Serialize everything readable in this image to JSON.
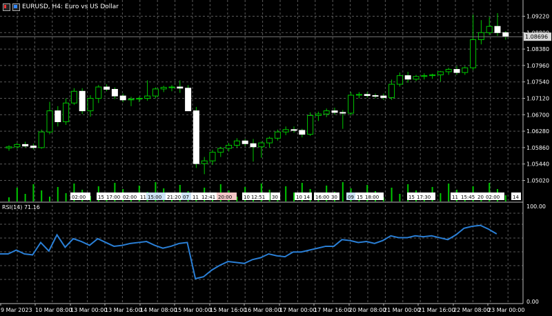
{
  "header": {
    "symbol": "EURUSD, H4:",
    "description": "Euro vs US Dollar"
  },
  "indicator": {
    "label": "RSI(14) 71.16"
  },
  "price_marker": "1.08696",
  "colors": {
    "background": "#000000",
    "grid": "#5a5a5a",
    "bull": "#00c800",
    "bear": "#ffffff",
    "rsi_line": "#2a7fd6",
    "volume": "#00c800",
    "price_line": "#7a7a7a"
  },
  "chart_data": [
    {
      "type": "candlestick",
      "y_ticks": [
        "1.09220",
        "1.08800",
        "1.08380",
        "1.07960",
        "1.07540",
        "1.07120",
        "1.06700",
        "1.06280",
        "1.05860",
        "1.05440",
        "1.05020"
      ],
      "ylim": [
        1.0487,
        1.0937
      ],
      "x_ticks": [
        "9 Mar 2023",
        "10 Mar 08:00",
        "13 Mar 00:00",
        "13 Mar 16:00",
        "14 Mar 08:00",
        "15 Mar 00:00",
        "15 Mar 16:00",
        "16 Mar 08:00",
        "17 Mar 00:00",
        "17 Mar 16:00",
        "20 Mar 08:00",
        "21 Mar 00:00",
        "21 Mar 16:00",
        "22 Mar 08:00",
        "23 Mar 00:00"
      ],
      "current_price": 1.08696,
      "candles": [
        {
          "o": 1.0585,
          "h": 1.0592,
          "l": 1.0578,
          "c": 1.0588
        },
        {
          "o": 1.0588,
          "h": 1.0598,
          "l": 1.0583,
          "c": 1.0594
        },
        {
          "o": 1.0594,
          "h": 1.0601,
          "l": 1.0586,
          "c": 1.059
        },
        {
          "o": 1.059,
          "h": 1.0596,
          "l": 1.0581,
          "c": 1.0586
        },
        {
          "o": 1.0586,
          "h": 1.0632,
          "l": 1.0583,
          "c": 1.0626
        },
        {
          "o": 1.0626,
          "h": 1.0703,
          "l": 1.062,
          "c": 1.068
        },
        {
          "o": 1.068,
          "h": 1.0692,
          "l": 1.064,
          "c": 1.0652
        },
        {
          "o": 1.0652,
          "h": 1.0712,
          "l": 1.0644,
          "c": 1.07
        },
        {
          "o": 1.07,
          "h": 1.0738,
          "l": 1.0695,
          "c": 1.073
        },
        {
          "o": 1.073,
          "h": 1.0738,
          "l": 1.0672,
          "c": 1.068
        },
        {
          "o": 1.068,
          "h": 1.072,
          "l": 1.0665,
          "c": 1.0712
        },
        {
          "o": 1.0712,
          "h": 1.0746,
          "l": 1.07,
          "c": 1.0741
        },
        {
          "o": 1.0741,
          "h": 1.0748,
          "l": 1.073,
          "c": 1.0735
        },
        {
          "o": 1.0735,
          "h": 1.074,
          "l": 1.071,
          "c": 1.0718
        },
        {
          "o": 1.0718,
          "h": 1.0724,
          "l": 1.0702,
          "c": 1.0708
        },
        {
          "o": 1.0708,
          "h": 1.0716,
          "l": 1.0692,
          "c": 1.071
        },
        {
          "o": 1.071,
          "h": 1.0716,
          "l": 1.0702,
          "c": 1.0712
        },
        {
          "o": 1.0712,
          "h": 1.0758,
          "l": 1.0706,
          "c": 1.0718
        },
        {
          "o": 1.0718,
          "h": 1.074,
          "l": 1.0712,
          "c": 1.0736
        },
        {
          "o": 1.0736,
          "h": 1.0744,
          "l": 1.0728,
          "c": 1.074
        },
        {
          "o": 1.074,
          "h": 1.0746,
          "l": 1.073,
          "c": 1.0741
        },
        {
          "o": 1.0741,
          "h": 1.0758,
          "l": 1.0726,
          "c": 1.0738
        },
        {
          "o": 1.0738,
          "h": 1.0746,
          "l": 1.0692,
          "c": 1.068
        },
        {
          "o": 1.068,
          "h": 1.069,
          "l": 1.0534,
          "c": 1.0545
        },
        {
          "o": 1.0545,
          "h": 1.0562,
          "l": 1.0518,
          "c": 1.0552
        },
        {
          "o": 1.0552,
          "h": 1.058,
          "l": 1.0542,
          "c": 1.0574
        },
        {
          "o": 1.0574,
          "h": 1.0588,
          "l": 1.0562,
          "c": 1.0584
        },
        {
          "o": 1.0584,
          "h": 1.0598,
          "l": 1.0576,
          "c": 1.0592
        },
        {
          "o": 1.0592,
          "h": 1.061,
          "l": 1.0586,
          "c": 1.0603
        },
        {
          "o": 1.0603,
          "h": 1.0608,
          "l": 1.059,
          "c": 1.0596
        },
        {
          "o": 1.0596,
          "h": 1.0608,
          "l": 1.055,
          "c": 1.0588
        },
        {
          "o": 1.0588,
          "h": 1.0602,
          "l": 1.056,
          "c": 1.0598
        },
        {
          "o": 1.0598,
          "h": 1.0614,
          "l": 1.0586,
          "c": 1.061
        },
        {
          "o": 1.061,
          "h": 1.0632,
          "l": 1.0604,
          "c": 1.0626
        },
        {
          "o": 1.0626,
          "h": 1.064,
          "l": 1.0618,
          "c": 1.0632
        },
        {
          "o": 1.0632,
          "h": 1.064,
          "l": 1.0624,
          "c": 1.063
        },
        {
          "o": 1.063,
          "h": 1.0634,
          "l": 1.0612,
          "c": 1.062
        },
        {
          "o": 1.062,
          "h": 1.0676,
          "l": 1.0616,
          "c": 1.0668
        },
        {
          "o": 1.0668,
          "h": 1.0678,
          "l": 1.0654,
          "c": 1.0672
        },
        {
          "o": 1.0672,
          "h": 1.0686,
          "l": 1.0664,
          "c": 1.068
        },
        {
          "o": 1.068,
          "h": 1.0688,
          "l": 1.067,
          "c": 1.0676
        },
        {
          "o": 1.0676,
          "h": 1.0682,
          "l": 1.0634,
          "c": 1.0674
        },
        {
          "o": 1.0674,
          "h": 1.0728,
          "l": 1.0668,
          "c": 1.072
        },
        {
          "o": 1.072,
          "h": 1.0728,
          "l": 1.0712,
          "c": 1.0722
        },
        {
          "o": 1.0722,
          "h": 1.0728,
          "l": 1.0714,
          "c": 1.0719
        },
        {
          "o": 1.0719,
          "h": 1.0724,
          "l": 1.0712,
          "c": 1.0718
        },
        {
          "o": 1.0718,
          "h": 1.0724,
          "l": 1.0708,
          "c": 1.0714
        },
        {
          "o": 1.0714,
          "h": 1.076,
          "l": 1.0708,
          "c": 1.0748
        },
        {
          "o": 1.0748,
          "h": 1.0778,
          "l": 1.0742,
          "c": 1.077
        },
        {
          "o": 1.077,
          "h": 1.078,
          "l": 1.0752,
          "c": 1.0761
        },
        {
          "o": 1.0761,
          "h": 1.0772,
          "l": 1.0756,
          "c": 1.0768
        },
        {
          "o": 1.0768,
          "h": 1.0776,
          "l": 1.076,
          "c": 1.077
        },
        {
          "o": 1.077,
          "h": 1.0775,
          "l": 1.0762,
          "c": 1.0772
        },
        {
          "o": 1.0772,
          "h": 1.0782,
          "l": 1.0755,
          "c": 1.078
        },
        {
          "o": 1.078,
          "h": 1.079,
          "l": 1.0772,
          "c": 1.0786
        },
        {
          "o": 1.0786,
          "h": 1.0794,
          "l": 1.0772,
          "c": 1.0778
        },
        {
          "o": 1.0778,
          "h": 1.0794,
          "l": 1.0772,
          "c": 1.079
        },
        {
          "o": 1.079,
          "h": 1.0926,
          "l": 1.0784,
          "c": 1.0862
        },
        {
          "o": 1.0862,
          "h": 1.0912,
          "l": 1.085,
          "c": 1.088
        },
        {
          "o": 1.088,
          "h": 1.092,
          "l": 1.0874,
          "c": 1.0896
        },
        {
          "o": 1.0896,
          "h": 1.093,
          "l": 1.0872,
          "c": 1.088
        },
        {
          "o": 1.088,
          "h": 1.0884,
          "l": 1.0862,
          "c": 1.087
        }
      ],
      "volume_labels": [
        "02:00",
        "15",
        "17:00",
        "02:00",
        "11",
        "15:00",
        "21:20",
        "07",
        "11",
        "12:41",
        "20:00",
        "10",
        "12:51",
        "30",
        "10",
        "14",
        "16:00",
        "30",
        "09",
        "15",
        "18:00",
        "15",
        "17:30",
        "11",
        "15:45",
        "20",
        "02:00",
        "14"
      ]
    },
    {
      "type": "line",
      "name": "RSI(14)",
      "ylim": [
        0,
        100
      ],
      "y_ticks": [
        "100.00",
        "0.00"
      ],
      "values": [
        50,
        50,
        54,
        50,
        49,
        62,
        53,
        70,
        57,
        66,
        63,
        59,
        66,
        62,
        58,
        59,
        61,
        62,
        63,
        59,
        56,
        58,
        61,
        62,
        24,
        26,
        33,
        38,
        42,
        41,
        40,
        44,
        46,
        50,
        48,
        47,
        52,
        52,
        54,
        56,
        58,
        58,
        65,
        64,
        62,
        63,
        61,
        64,
        69,
        67,
        67,
        69,
        68,
        69,
        67,
        65,
        70,
        77,
        79,
        80,
        76,
        71
      ]
    }
  ]
}
